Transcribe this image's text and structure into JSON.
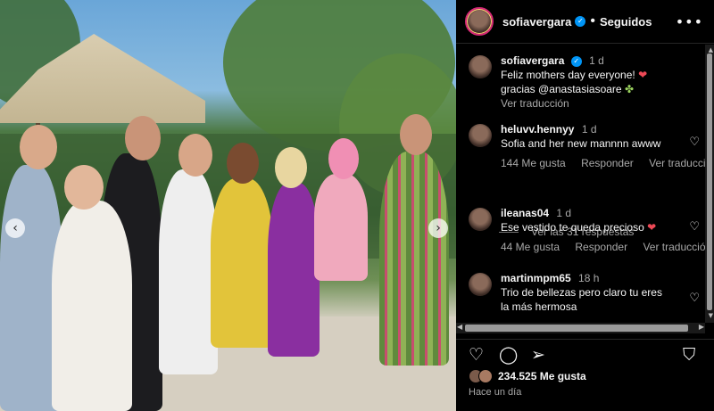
{
  "header": {
    "username": "sofiavergara",
    "follow_status": "Seguidos",
    "more_icon": "more-horizontal-icon"
  },
  "caption": {
    "username": "sofiavergara",
    "time": "1 d",
    "text_line1": "Feliz mothers day everyone!",
    "text_line2": "gracias @anastasiasoare",
    "translate": "Ver traducción"
  },
  "comments": [
    {
      "username": "heluvv.hennyy",
      "time": "1 d",
      "text": "Sofia and her new mannnn awww",
      "likes": "144 Me gusta",
      "reply": "Responder",
      "translate": "Ver traducción",
      "view_replies": "Ver las 31 respuestas"
    },
    {
      "username": "ileanas04",
      "time": "1 d",
      "text": "Ese vestido te queda precioso",
      "likes": "44 Me gusta",
      "reply": "Responder",
      "translate": "Ver traducción"
    },
    {
      "username": "martinmpm65",
      "time": "18 h",
      "text_line1": "Trio de bellezas pero claro tu eres",
      "text_line2": "la más hermosa"
    }
  ],
  "actions": {
    "icons": [
      "heart-icon",
      "comment-icon",
      "share-icon",
      "bookmark-icon"
    ]
  },
  "likes_count": "234.525 Me gusta",
  "posted_ago": "Hace un día",
  "colors": {
    "background": "#000000",
    "text": "#f5f5f5",
    "muted": "#a8a8a8",
    "verified": "#0095f6",
    "heart": "#ed4956"
  }
}
